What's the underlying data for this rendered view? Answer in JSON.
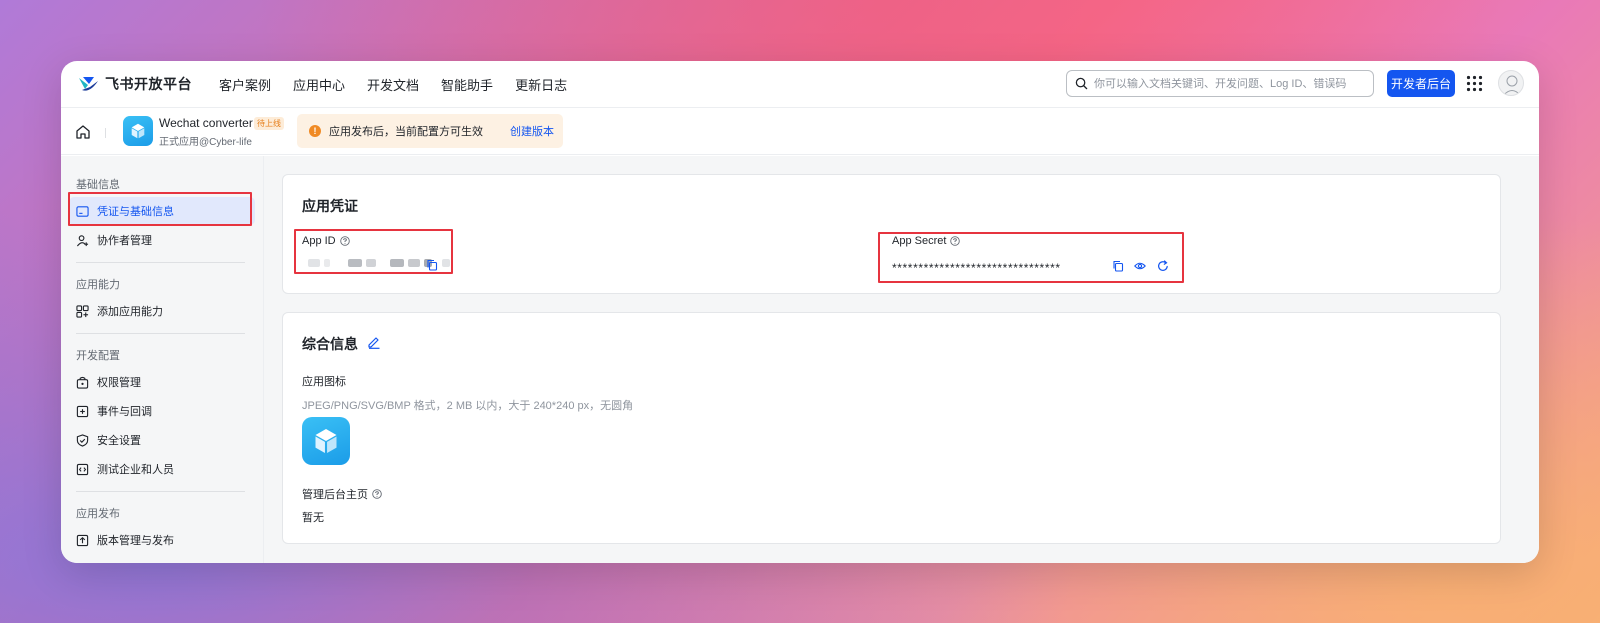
{
  "brand": {
    "name": "飞书开放平台"
  },
  "nav": {
    "links": [
      "客户案例",
      "应用中心",
      "开发文档",
      "智能助手",
      "更新日志"
    ]
  },
  "search": {
    "placeholder": "你可以输入文档关键词、开发问题、Log ID、错误码"
  },
  "header": {
    "dev_console_label": "开发者后台"
  },
  "app": {
    "name": "Wechat converter",
    "badge": "待上线",
    "subtitle": "正式应用@Cyber-life"
  },
  "notice": {
    "text": "应用发布后，当前配置方可生效",
    "link": "创建版本"
  },
  "sidebar": {
    "sections": [
      {
        "title": "基础信息",
        "items": [
          "凭证与基础信息",
          "协作者管理"
        ]
      },
      {
        "title": "应用能力",
        "items": [
          "添加应用能力"
        ]
      },
      {
        "title": "开发配置",
        "items": [
          "权限管理",
          "事件与回调",
          "安全设置",
          "测试企业和人员"
        ]
      },
      {
        "title": "应用发布",
        "items": [
          "版本管理与发布"
        ]
      }
    ]
  },
  "credentials": {
    "title": "应用凭证",
    "app_id_label": "App ID",
    "app_secret_label": "App Secret",
    "app_secret_value": "********************************"
  },
  "general": {
    "title": "综合信息",
    "icon_label": "应用图标",
    "icon_hint": "JPEG/PNG/SVG/BMP 格式，2 MB 以内，大于 240*240 px，无圆角",
    "homepage_label": "管理后台主页",
    "homepage_value": "暂无"
  },
  "colors": {
    "primary": "#1456f0",
    "highlight_border": "#e6343f",
    "warning": "#f08a24"
  }
}
